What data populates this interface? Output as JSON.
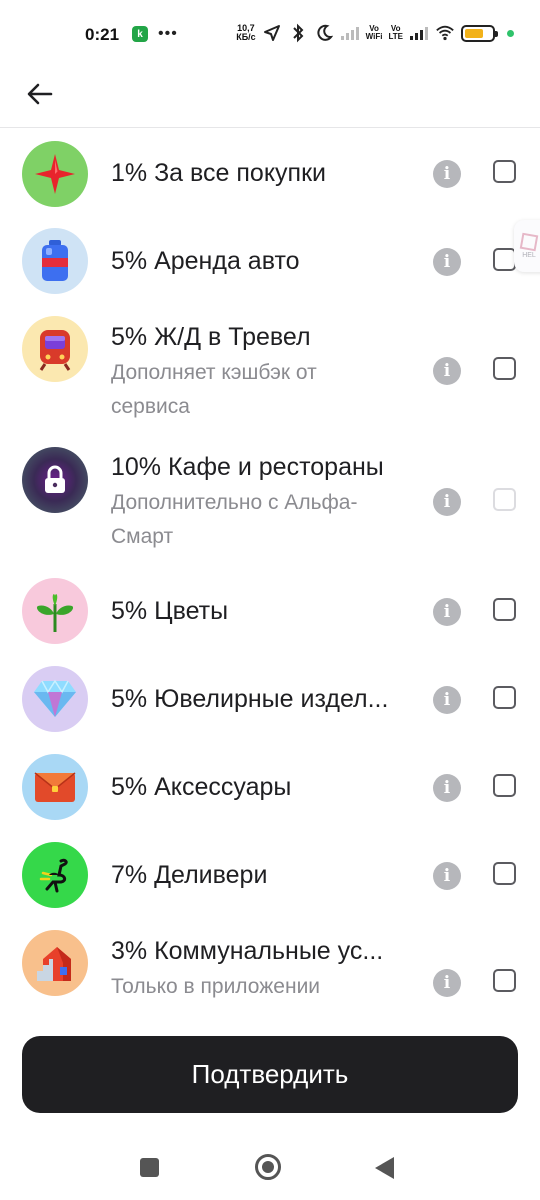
{
  "status_bar": {
    "time": "0:21",
    "dots": "•••",
    "speed_value": "10,7",
    "speed_unit": "КБ/с",
    "vo_wifi_top": "Vo",
    "vo_wifi_bottom": "WiFi",
    "vo_lte_top": "Vo",
    "vo_lte_bottom": "LTE",
    "battery_level": 0.7,
    "battery_color": "#f2b21a"
  },
  "header": {
    "back_icon": "arrow-left-icon"
  },
  "categories": [
    {
      "title": "1% За все покупки",
      "subtitle": "",
      "icon": "star-icon",
      "bg": "#7fd166",
      "enabled": true
    },
    {
      "title": "5% Аренда авто",
      "subtitle": "",
      "icon": "gas-can-icon",
      "bg": "#cfe3f5",
      "enabled": true
    },
    {
      "title": "5% Ж/Д в Тревел",
      "subtitle": "Дополняет кэшбэк от сервиса",
      "icon": "train-icon",
      "bg": "#fbe8b0",
      "enabled": true
    },
    {
      "title": "10% Кафе и рестораны",
      "subtitle": "Дополнительно с Альфа-Смарт",
      "icon": "lock-icon",
      "bg": "#3d4a52",
      "enabled": false
    },
    {
      "title": "5% Цветы",
      "subtitle": "",
      "icon": "sprout-icon",
      "bg": "#f8c9dc",
      "enabled": true
    },
    {
      "title": "5% Ювелирные издел...",
      "subtitle": "",
      "icon": "diamond-icon",
      "bg": "#d9cdf3",
      "enabled": true
    },
    {
      "title": "5% Аксессуары",
      "subtitle": "",
      "icon": "bag-icon",
      "bg": "#a9d8f5",
      "enabled": true
    },
    {
      "title": "7% Деливери",
      "subtitle": "",
      "icon": "ostrich-icon",
      "bg": "#35d84a",
      "enabled": true
    },
    {
      "title": "3% Коммунальные ус...",
      "subtitle": "Только в приложении",
      "icon": "house-icon",
      "bg": "#f8c08c",
      "enabled": true
    }
  ],
  "info_glyph": "i",
  "confirm_label": "Подтвердить",
  "float_help_label": "HEL"
}
